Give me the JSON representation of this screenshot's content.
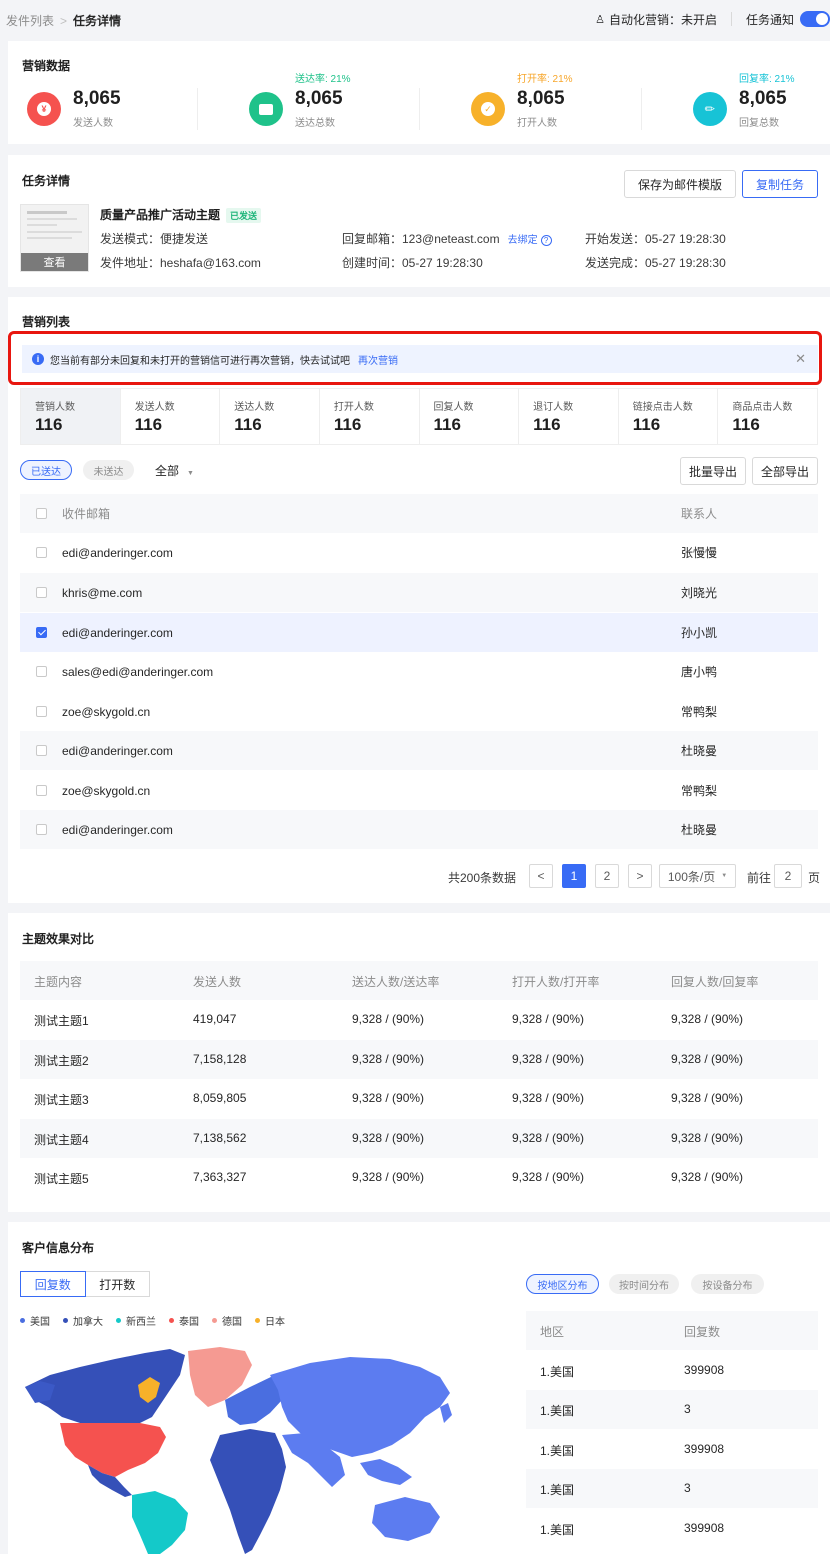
{
  "breadcrumb": {
    "parent": "发件列表",
    "current": "任务详情"
  },
  "header": {
    "automation_label": "自动化营销：",
    "automation_value": "未开启",
    "notify_label": "任务通知",
    "notify_on": true
  },
  "marketing_data": {
    "title": "营销数据",
    "stats": [
      {
        "rate": "",
        "value": "8,065",
        "label": "发送人数",
        "icon": "yen-icon",
        "glyph": "¥",
        "color": "#f5524f",
        "rate_color": ""
      },
      {
        "rate": "送达率: 21%",
        "value": "8,065",
        "label": "送达总数",
        "icon": "briefcase-icon",
        "glyph": "▣",
        "color": "#1fc28a",
        "rate_color": "#1fc28a"
      },
      {
        "rate": "打开率: 21%",
        "value": "8,065",
        "label": "打开人数",
        "icon": "check-icon",
        "glyph": "✓",
        "color": "#f7b12a",
        "rate_color": "#f7a62a"
      },
      {
        "rate": "回复率: 21%",
        "value": "8,065",
        "label": "回复总数",
        "icon": "reply-icon",
        "glyph": "⟿",
        "color": "#17c3d6",
        "rate_color": "#17c3d6"
      }
    ]
  },
  "task_detail": {
    "title": "任务详情",
    "save_template_label": "保存为邮件模版",
    "copy_task_label": "复制任务",
    "subject": "质量产品推广活动主题",
    "status_tag": "已发送",
    "thumbnail_view_label": "查看",
    "send_mode": "发送模式：便捷发送",
    "sender": "发件地址：heshafa@163.com",
    "reply_mailbox": "回复邮箱：123@neteast.com",
    "bind_link": "去绑定",
    "created_time": "创建时间：05-27  19:28:30",
    "start_send": "开始发送：05-27  19:28:30",
    "send_done": "发送完成：05-27  19:28:30"
  },
  "marketing_list": {
    "title": "营销列表",
    "alert_text": "您当前有部分未回复和未打开的营销信可进行再次营销，快去试试吧",
    "alert_link": "再次营销",
    "counts": [
      {
        "label": "营销人数",
        "value": "116"
      },
      {
        "label": "发送人数",
        "value": "116"
      },
      {
        "label": "送达人数",
        "value": "116"
      },
      {
        "label": "打开人数",
        "value": "116"
      },
      {
        "label": "回复人数",
        "value": "116"
      },
      {
        "label": "退订人数",
        "value": "116"
      },
      {
        "label": "链接点击人数",
        "value": "116"
      },
      {
        "label": "商品点击人数",
        "value": "116"
      }
    ],
    "filter_sent": "已送达",
    "filter_unsent": "未送达",
    "filter_all": "全部",
    "batch_export": "批量导出",
    "export_all": "全部导出",
    "columns": {
      "email": "收件邮箱",
      "contact": "联系人"
    },
    "rows": [
      {
        "email": "edi@anderinger.com",
        "contact": "张慢慢",
        "checked": false
      },
      {
        "email": "khris@me.com",
        "contact": "刘晓光",
        "checked": false
      },
      {
        "email": "edi@anderinger.com",
        "contact": "孙小凯",
        "checked": true
      },
      {
        "email": "sales@edi@anderinger.com",
        "contact": "唐小鸭",
        "checked": false
      },
      {
        "email": "zoe@skygold.cn",
        "contact": "常鸭梨",
        "checked": false
      },
      {
        "email": "edi@anderinger.com",
        "contact": "杜晓曼",
        "checked": false
      },
      {
        "email": "zoe@skygold.cn",
        "contact": "常鸭梨",
        "checked": false
      },
      {
        "email": "edi@anderinger.com",
        "contact": "杜晓曼",
        "checked": false
      }
    ],
    "pagination": {
      "total": "共200条数据",
      "prev": "<",
      "pages": [
        "1",
        "2"
      ],
      "current": "1",
      "next": ">",
      "page_size": "100条/页",
      "goto_label": "前往",
      "goto_value": "2",
      "page_unit": "页"
    }
  },
  "theme_compare": {
    "title": "主题效果对比",
    "columns": [
      "主题内容",
      "发送人数",
      "送达人数/送达率",
      "打开人数/打开率",
      "回复人数/回复率"
    ],
    "rows": [
      [
        "测试主题1",
        "419,047",
        "9,328 / (90%)",
        "9,328 / (90%)",
        "9,328 / (90%)"
      ],
      [
        "测试主题2",
        "7,158,128",
        "9,328 / (90%)",
        "9,328 / (90%)",
        "9,328 / (90%)"
      ],
      [
        "测试主题3",
        "8,059,805",
        "9,328 / (90%)",
        "9,328 / (90%)",
        "9,328 / (90%)"
      ],
      [
        "测试主题4",
        "7,138,562",
        "9,328 / (90%)",
        "9,328 / (90%)",
        "9,328 / (90%)"
      ],
      [
        "测试主题5",
        "7,363,327",
        "9,328 / (90%)",
        "9,328 / (90%)",
        "9,328 / (90%)"
      ]
    ]
  },
  "customer_dist": {
    "title": "客户信息分布",
    "tabs": [
      "回复数",
      "打开数"
    ],
    "dist_tabs": [
      "按地区分布",
      "按时间分布",
      "按设备分布"
    ],
    "legend": [
      {
        "name": "美国",
        "color": "#4a6ee0"
      },
      {
        "name": "加拿大",
        "color": "#3550b8"
      },
      {
        "name": "新西兰",
        "color": "#14c9c9"
      },
      {
        "name": "泰国",
        "color": "#f5524f"
      },
      {
        "name": "德国",
        "color": "#f59a92"
      },
      {
        "name": "日本",
        "color": "#f7b12a"
      }
    ],
    "region_columns": [
      "地区",
      "回复数"
    ],
    "region_rows": [
      [
        "1.美国",
        "399908"
      ],
      [
        "1.美国",
        "3"
      ],
      [
        "1.美国",
        "399908"
      ],
      [
        "1.美国",
        "3"
      ],
      [
        "1.美国",
        "399908"
      ]
    ]
  }
}
